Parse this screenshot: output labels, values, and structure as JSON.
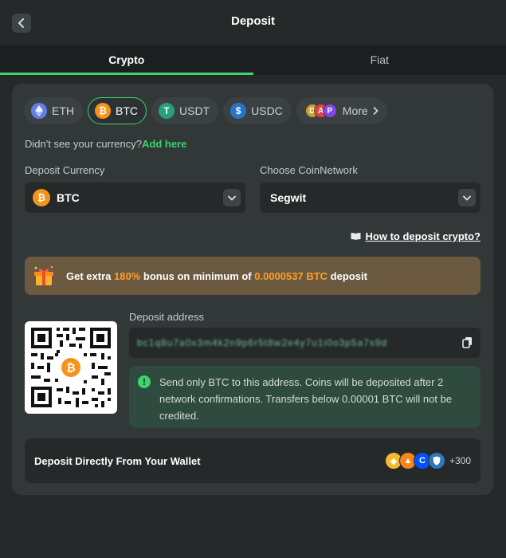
{
  "header": {
    "title": "Deposit"
  },
  "tabs": [
    {
      "label": "Crypto"
    },
    {
      "label": "Fiat"
    }
  ],
  "currencies": [
    {
      "symbol": "ETH",
      "icon": "eth-icon",
      "color": "#627eea"
    },
    {
      "symbol": "BTC",
      "icon": "btc-icon",
      "color": "#f7931a"
    },
    {
      "symbol": "USDT",
      "icon": "usdt-icon",
      "color": "#26a17b"
    },
    {
      "symbol": "USDC",
      "icon": "usdc-icon",
      "color": "#2775ca"
    }
  ],
  "more_label": "More",
  "hint": {
    "text": "Didn't see your currency?",
    "link": "Add here"
  },
  "deposit_currency": {
    "label": "Deposit Currency",
    "value": "BTC"
  },
  "coin_network": {
    "label": "Choose CoinNetwork",
    "value": "Segwit"
  },
  "howto": {
    "label": "How to deposit crypto?"
  },
  "bonus": {
    "prefix": "Get extra",
    "percent": "180%",
    "middle": "bonus on minimum of",
    "amount": "0.0000537 BTC",
    "suffix": "deposit"
  },
  "address": {
    "label": "Deposit address",
    "value": "bc1q8u7a0x3m4k2n9p6r5t8w2e4y7u1i0o3p5a7s9d"
  },
  "notice": {
    "text": "Send only BTC to this address. Coins will be deposited after 2 network confirmations. Transfers below 0.00001 BTC will not be credited."
  },
  "wallet": {
    "label": "Deposit Directly From Your Wallet",
    "count": "+300"
  },
  "colors": {
    "accent": "#3bd46e",
    "bonus_highlight": "#ff9d2e",
    "panel": "#323738"
  }
}
